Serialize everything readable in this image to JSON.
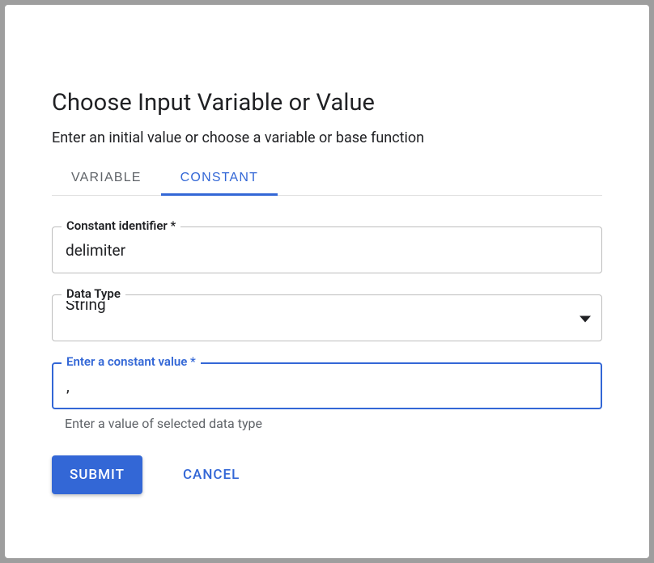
{
  "dialog": {
    "title": "Choose Input Variable or Value",
    "subtitle": "Enter an initial value or choose a variable or base function"
  },
  "tabs": {
    "variable": "VARIABLE",
    "constant": "CONSTANT"
  },
  "fields": {
    "identifier": {
      "label": "Constant identifier *",
      "value": "delimiter"
    },
    "datatype": {
      "label": "Data Type",
      "value": "String"
    },
    "constvalue": {
      "label": "Enter a constant value *",
      "value": ",",
      "helper": "Enter a value of selected data type"
    }
  },
  "actions": {
    "submit": "SUBMIT",
    "cancel": "CANCEL"
  }
}
